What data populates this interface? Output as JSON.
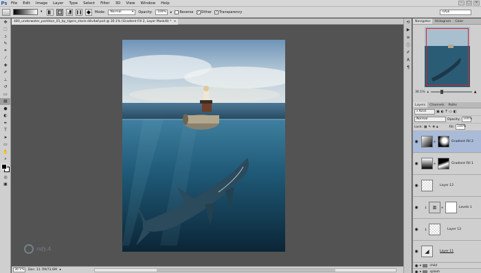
{
  "app": {
    "logo": "Ps",
    "menu": [
      "File",
      "Edit",
      "Image",
      "Layer",
      "Type",
      "Select",
      "Filter",
      "3D",
      "View",
      "Window",
      "Help"
    ],
    "window_controls": [
      "–",
      "□",
      "×"
    ]
  },
  "options": {
    "mode_label": "Mode:",
    "mode_value": "Normal",
    "opacity_label": "Opacity:",
    "opacity_value": "100%",
    "reverse_label": "Reverse",
    "reverse_checked": false,
    "dither_label": "Dither",
    "dither_checked": true,
    "transparency_label": "Transparency",
    "transparency_checked": true,
    "workspace_value": "rafyk"
  },
  "document": {
    "tab_title": "480_underwater_partition_01_by_tigers_stock-d4v4wf.psd @ 30.1% (Gradient Fill 2, Layer Mask/8) *",
    "close": "×"
  },
  "status": {
    "zoom": "30.1%",
    "doc_info": "Doc: 11.7M/73.6M"
  },
  "watermark": "rafy A",
  "navigator": {
    "tabs": [
      "Navigator",
      "Histogram",
      "Color"
    ],
    "zoom": "30.1%"
  },
  "layers_panel": {
    "tabs": [
      "Layers",
      "Channels",
      "Paths"
    ],
    "kind_label": "Kind",
    "blend_mode": "Normal",
    "opacity_label": "Opacity:",
    "opacity_value": "100%",
    "lock_label": "Lock:",
    "fill_label": "Fill:",
    "fill_value": "100%",
    "layers": [
      {
        "name": "Gradient Fill 2"
      },
      {
        "name": "Gradient Fill 1"
      },
      {
        "name": "Layer 12"
      },
      {
        "name": "Levels 1"
      },
      {
        "name": "Layer 12"
      },
      {
        "name": "Layer 11"
      }
    ],
    "groups": [
      "child",
      "splash"
    ]
  },
  "colors": {
    "chrome": "#d6d6d6",
    "canvas_bg": "#535353",
    "selected_layer": "#a9bbd8",
    "nav_box": "#e02020"
  }
}
